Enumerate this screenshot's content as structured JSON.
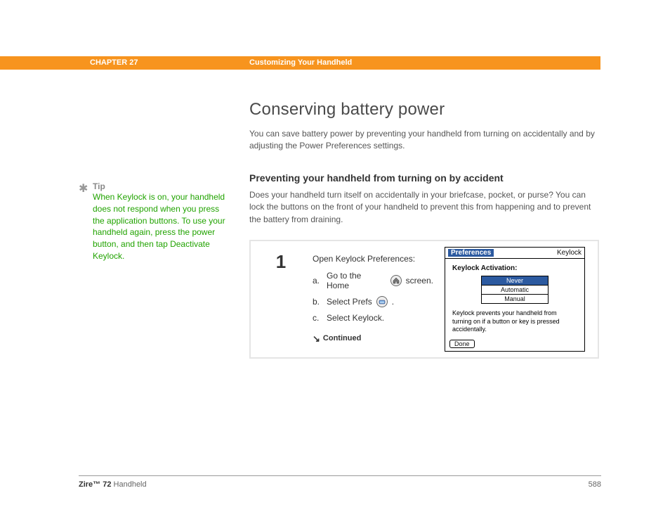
{
  "header": {
    "chapter": "CHAPTER 27",
    "section": "Customizing Your Handheld"
  },
  "main": {
    "title": "Conserving battery power",
    "intro": "You can save battery power by preventing your handheld from turning on accidentally and by adjusting the Power Preferences settings.",
    "subhead": "Preventing your handheld from turning on by accident",
    "paragraph": "Does your handheld turn itself on accidentally in your briefcase, pocket, or purse? You can lock the buttons on the front of your handheld to prevent this from happening and to prevent the battery from draining."
  },
  "tip": {
    "label": "Tip",
    "text": "When Keylock is on, your handheld does not respond when you press the application buttons. To use your handheld again, press the power button, and then tap Deactivate Keylock."
  },
  "step": {
    "number": "1",
    "lead": "Open Keylock Preferences:",
    "items": {
      "a_marker": "a.",
      "a_pre": "Go to the Home",
      "a_post": "screen.",
      "b_marker": "b.",
      "b_pre": "Select Prefs",
      "b_post": ".",
      "c_marker": "c.",
      "c_text": "Select Keylock."
    },
    "continued": "Continued"
  },
  "device": {
    "prefs": "Preferences",
    "corner": "Keylock",
    "heading": "Keylock Activation:",
    "options": {
      "never": "Never",
      "automatic": "Automatic",
      "manual": "Manual"
    },
    "desc": "Keylock prevents your handheld from turning on if a button or key is pressed accidentally.",
    "done": "Done"
  },
  "footer": {
    "bold": "Zire™ 72",
    "rest": " Handheld",
    "page": "588"
  }
}
